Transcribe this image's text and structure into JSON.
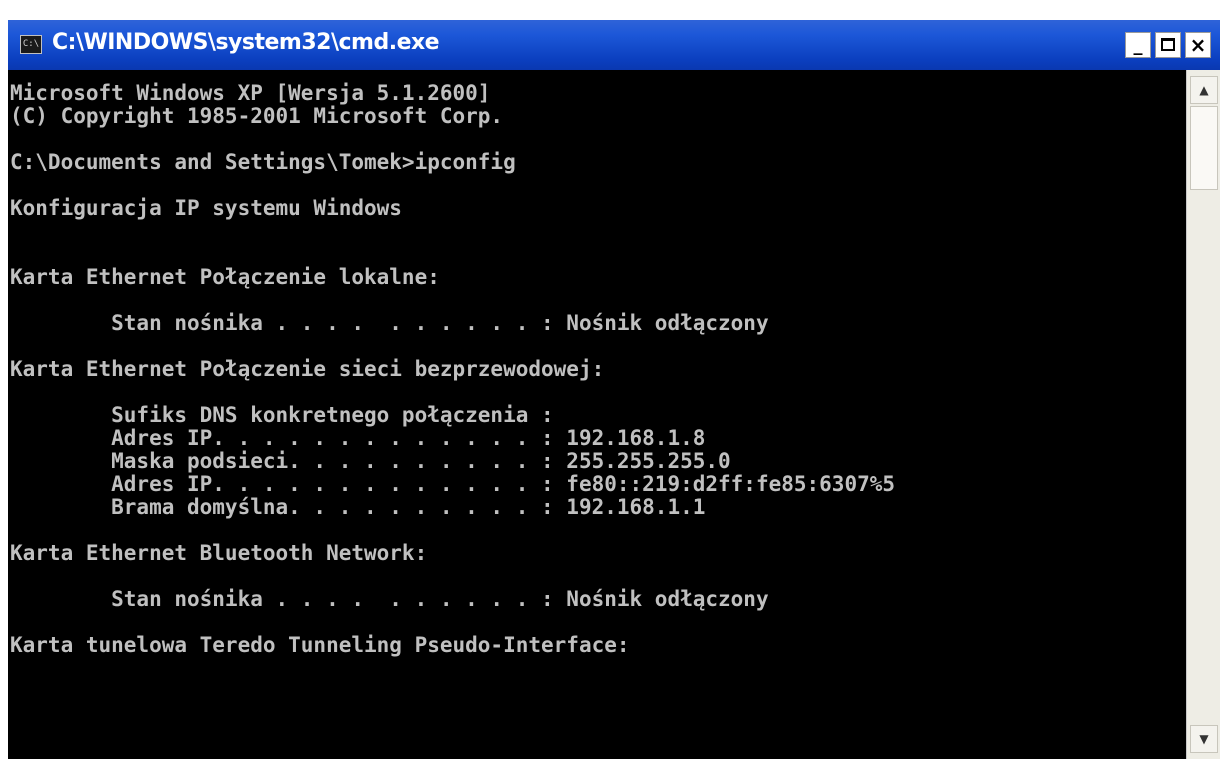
{
  "window": {
    "title": "C:\\WINDOWS\\system32\\cmd.exe",
    "icon_text": "C:\\",
    "icon": "cmd-icon",
    "buttons": {
      "minimize_icon": "minimize-icon",
      "maximize_icon": "maximize-icon",
      "close_icon": "close-icon",
      "minimize_glyph": "_",
      "close_glyph": "×"
    }
  },
  "colors": {
    "titlebar": "#0b3fbf",
    "console_bg": "#000000",
    "console_text": "#c0c0c0"
  },
  "console": {
    "lines": [
      "Microsoft Windows XP [Wersja 5.1.2600]",
      "(C) Copyright 1985-2001 Microsoft Corp.",
      "",
      "C:\\Documents and Settings\\Tomek>ipconfig",
      "",
      "Konfiguracja IP systemu Windows",
      "",
      "",
      "Karta Ethernet Połączenie lokalne:",
      "",
      "        Stan nośnika . . . .  . . . . . . : Nośnik odłączony",
      "",
      "Karta Ethernet Połączenie sieci bezprzewodowej:",
      "",
      "        Sufiks DNS konkretnego połączenia :",
      "        Adres IP. . . . . . . . . . . . . : 192.168.1.8",
      "        Maska podsieci. . . . . . . . . . : 255.255.255.0",
      "        Adres IP. . . . . . . . . . . . . : fe80::219:d2ff:fe85:6307%5",
      "        Brama domyślna. . . . . . . . . . : 192.168.1.1",
      "",
      "Karta Ethernet Bluetooth Network:",
      "",
      "        Stan nośnika . . . .  . . . . . . : Nośnik odłączony",
      "",
      "Karta tunelowa Teredo Tunneling Pseudo-Interface:"
    ]
  },
  "scrollbar": {
    "up_icon": "scroll-up-arrow-icon",
    "down_icon": "scroll-down-arrow-icon",
    "up_glyph": "▲",
    "down_glyph": "▼"
  }
}
